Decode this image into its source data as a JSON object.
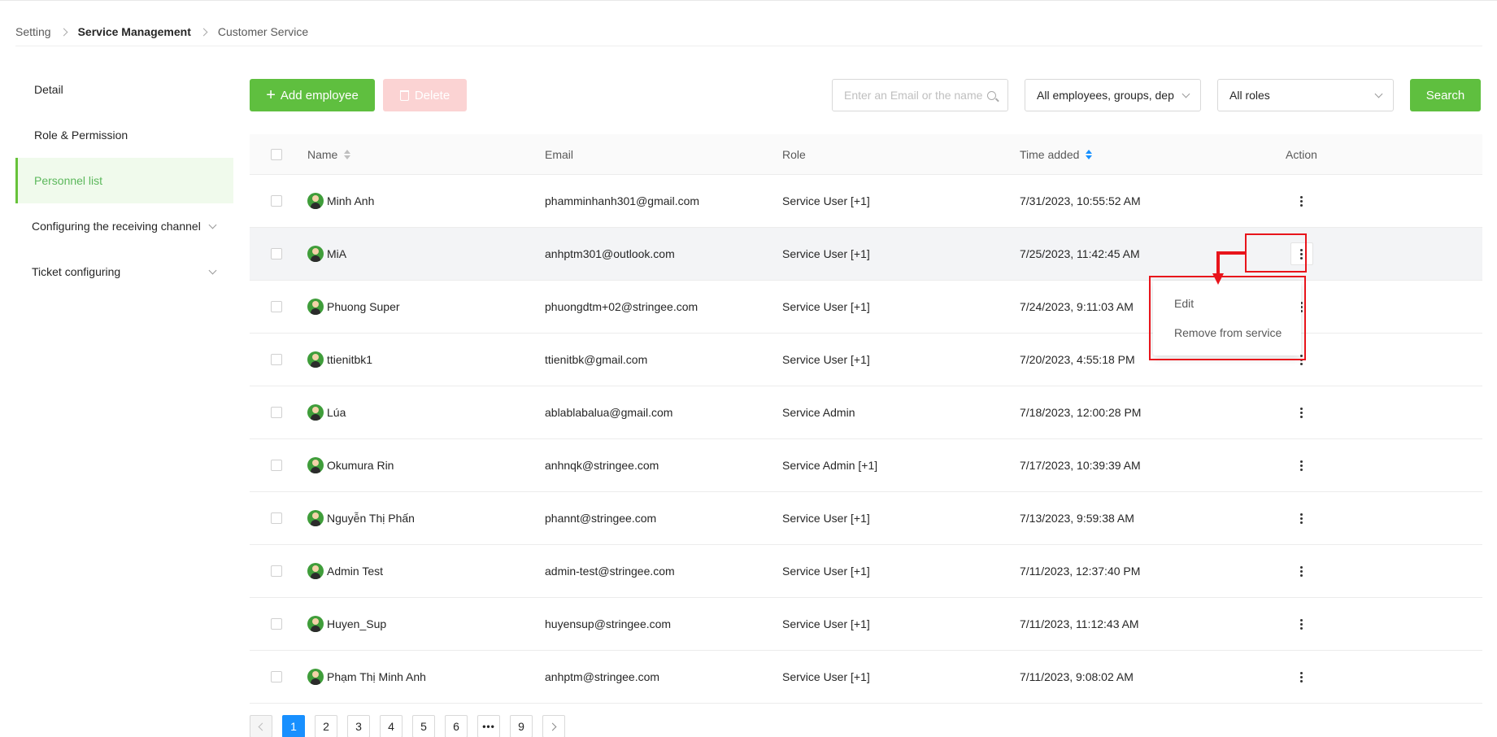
{
  "breadcrumb": {
    "item1": "Setting",
    "item2": "Service Management",
    "item3": "Customer Service"
  },
  "sidebar": {
    "items": [
      {
        "label": "Detail"
      },
      {
        "label": "Role & Permission"
      },
      {
        "label": "Personnel list"
      },
      {
        "label": "Configuring the receiving channel"
      },
      {
        "label": "Ticket configuring"
      }
    ],
    "active_index": 2
  },
  "toolbar": {
    "add_label": "Add employee",
    "delete_label": "Delete",
    "search_placeholder": "Enter an Email or the name",
    "employee_filter": "All employees, groups, dep",
    "role_filter": "All roles",
    "search_label": "Search"
  },
  "table": {
    "headers": {
      "name": "Name",
      "email": "Email",
      "role": "Role",
      "time": "Time added",
      "action": "Action"
    },
    "rows": [
      {
        "name": "Minh Anh",
        "email": "phamminhanh301@gmail.com",
        "role": "Service User [+1]",
        "time": "7/31/2023, 10:55:52 AM"
      },
      {
        "name": "MiA",
        "email": "anhptm301@outlook.com",
        "role": "Service User [+1]",
        "time": "7/25/2023, 11:42:45 AM"
      },
      {
        "name": "Phuong Super",
        "email": "phuongdtm+02@stringee.com",
        "role": "Service User [+1]",
        "time": "7/24/2023, 9:11:03 AM"
      },
      {
        "name": "ttienitbk1",
        "email": "ttienitbk@gmail.com",
        "role": "Service User [+1]",
        "time": "7/20/2023, 4:55:18 PM"
      },
      {
        "name": "Lúa",
        "email": "ablablabalua@gmail.com",
        "role": "Service Admin",
        "time": "7/18/2023, 12:00:28 PM"
      },
      {
        "name": "Okumura Rin",
        "email": "anhnqk@stringee.com",
        "role": "Service Admin [+1]",
        "time": "7/17/2023, 10:39:39 AM"
      },
      {
        "name": "Nguyễn Thị Phấn",
        "email": "phannt@stringee.com",
        "role": "Service User [+1]",
        "time": "7/13/2023, 9:59:38 AM"
      },
      {
        "name": "Admin Test",
        "email": "admin-test@stringee.com",
        "role": "Service User [+1]",
        "time": "7/11/2023, 12:37:40 PM"
      },
      {
        "name": "Huyen_Sup",
        "email": "huyensup@stringee.com",
        "role": "Service User [+1]",
        "time": "7/11/2023, 11:12:43 AM"
      },
      {
        "name": "Phạm Thị Minh Anh",
        "email": "anhptm@stringee.com",
        "role": "Service User [+1]",
        "time": "7/11/2023, 9:08:02 AM"
      }
    ]
  },
  "action_menu": {
    "edit": "Edit",
    "remove": "Remove from service"
  },
  "pagination": {
    "pages": [
      "1",
      "2",
      "3",
      "4",
      "5",
      "6",
      "9"
    ],
    "current": "1"
  },
  "colors": {
    "primary": "#5fbf3f",
    "danger_disabled": "#fbd3d3",
    "page_active": "#1890ff",
    "annotation": "#e8141b"
  }
}
